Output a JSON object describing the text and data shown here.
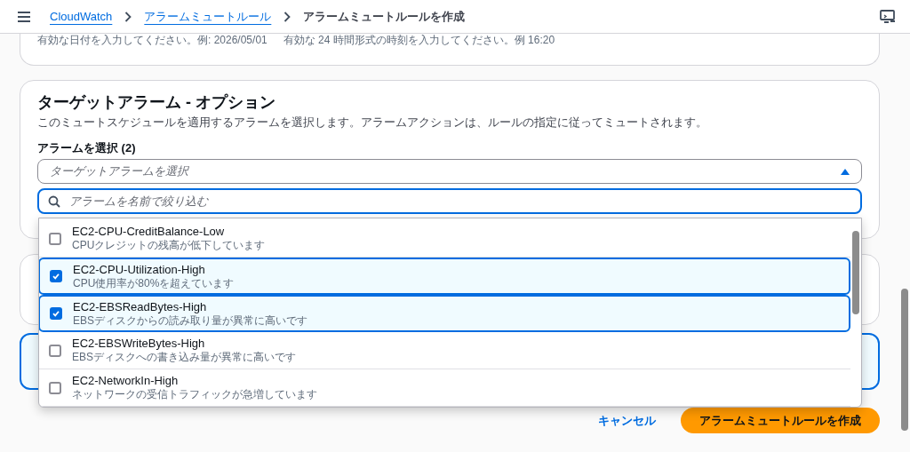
{
  "header": {
    "breadcrumbs": [
      {
        "label": "CloudWatch",
        "link": true
      },
      {
        "label": "アラームミュートルール",
        "link": true
      },
      {
        "label": "アラームミュートルールを作成",
        "link": false
      }
    ]
  },
  "date_hints": [
    "有効な日付を入力してください。例: 2026/05/01",
    "有効な 24 時間形式の時刻を入力してください。例 16:20"
  ],
  "target": {
    "title": "ターゲットアラーム - オプション",
    "description": "このミュートスケジュールを適用するアラームを選択します。アラームアクションは、ルールの指定に従ってミュートされます。",
    "field_label": "アラームを選択 (2)",
    "select_placeholder": "ターゲットアラームを選択",
    "expanded": true,
    "filter_placeholder": "アラームを名前で絞り込む",
    "options": [
      {
        "name": "EC2-CPU-CreditBalance-Low",
        "description": "CPUクレジットの残高が低下しています",
        "checked": false
      },
      {
        "name": "EC2-CPU-Utilization-High",
        "description": "CPU使用率が80%を超えています",
        "checked": true
      },
      {
        "name": "EC2-EBSReadBytes-High",
        "description": "EBSディスクからの読み取り量が異常に高いです",
        "checked": true
      },
      {
        "name": "EC2-EBSWriteBytes-High",
        "description": "EBSディスクへの書き込み量が異常に高いです",
        "checked": false
      },
      {
        "name": "EC2-NetworkIn-High",
        "description": "ネットワークの受信トラフィックが急増しています",
        "checked": false
      }
    ]
  },
  "actions": {
    "cancel": "キャンセル",
    "submit": "アラームミュートルールを作成"
  }
}
